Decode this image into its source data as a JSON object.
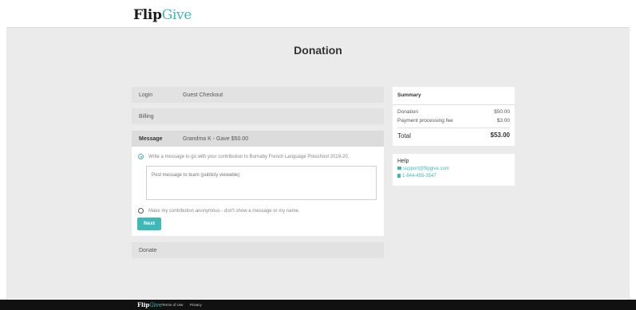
{
  "header": {
    "logo_part1": "Flip",
    "logo_part2": "Give"
  },
  "page": {
    "title": "Donation"
  },
  "steps": {
    "login": {
      "label": "Login",
      "value": "Guest Checkout"
    },
    "billing": {
      "label": "Billing"
    },
    "message": {
      "label": "Message",
      "value": "Grandma K - Gave $50.00"
    },
    "donate": {
      "label": "Donate"
    }
  },
  "message_form": {
    "option_write": "Write a message to go with your contribution to Burnaby French Language Preschool 2019-20.",
    "textarea_placeholder": "Post message to team (publicly viewable)",
    "option_anonymous": "Make my contribution anonymous - don't show a message or my name.",
    "selected_option": "write",
    "next_label": "Next"
  },
  "summary": {
    "title": "Summary",
    "donation_label": "Donation",
    "donation_value": "$50.00",
    "fee_label": "Payment processing fee",
    "fee_value": "$3.00",
    "total_label": "Total",
    "total_value": "$53.00"
  },
  "help": {
    "title": "Help",
    "email": "support@flipgive.com",
    "phone": "1-844-455-3547",
    "email_icon": "envelope-icon",
    "phone_icon": "phone-icon"
  },
  "footer": {
    "logo_part1": "Flip",
    "logo_part2": "Give",
    "terms": "Terms of Use",
    "privacy": "Privacy"
  },
  "colors": {
    "accent": "#3fb8b8",
    "background": "#ebebeb",
    "footer": "#111111"
  }
}
